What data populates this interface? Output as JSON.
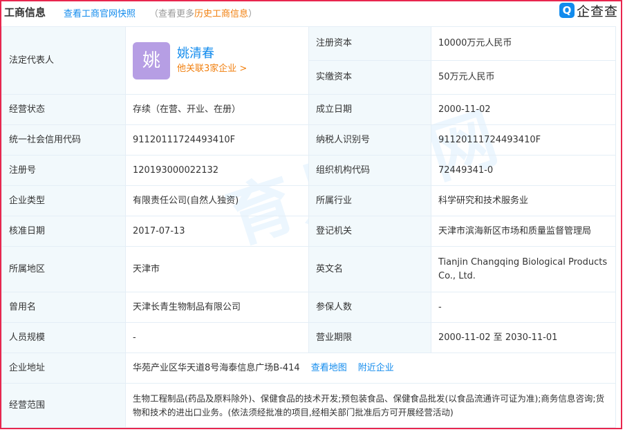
{
  "header": {
    "title": "工商信息",
    "snapshot_link": "查看工商官网快照",
    "more_prefix": "（查看更多",
    "history_link": "历史工商信息",
    "more_suffix": "）",
    "brand_logo": "Q",
    "brand_name": "企查查"
  },
  "legal_rep": {
    "label": "法定代表人",
    "avatar_char": "姚",
    "name": "姚清春",
    "related": "他关联3家企业 >"
  },
  "rows": {
    "reg_capital": {
      "label": "注册资本",
      "value": "10000万元人民币"
    },
    "paid_capital": {
      "label": "实缴资本",
      "value": "50万元人民币"
    },
    "status": {
      "label": "经营状态",
      "value": "存续（在营、开业、在册）"
    },
    "found_date": {
      "label": "成立日期",
      "value": "2000-11-02"
    },
    "credit_code": {
      "label": "统一社会信用代码",
      "value": "91120111724493410F"
    },
    "taxpayer_id": {
      "label": "纳税人识别号",
      "value": "91120111724493410F"
    },
    "reg_no": {
      "label": "注册号",
      "value": "120193000022132"
    },
    "org_code": {
      "label": "组织机构代码",
      "value": "72449341-0"
    },
    "company_type": {
      "label": "企业类型",
      "value": "有限责任公司(自然人独资)"
    },
    "industry": {
      "label": "所属行业",
      "value": "科学研究和技术服务业"
    },
    "approval_date": {
      "label": "核准日期",
      "value": "2017-07-13"
    },
    "authority": {
      "label": "登记机关",
      "value": "天津市滨海新区市场和质量监督管理局"
    },
    "region": {
      "label": "所属地区",
      "value": "天津市"
    },
    "english_name": {
      "label": "英文名",
      "value": "Tianjin Changqing Biological Products Co., Ltd."
    },
    "former_name": {
      "label": "曾用名",
      "value": "天津长青生物制品有限公司"
    },
    "insured": {
      "label": "参保人数",
      "value": "-"
    },
    "staff_size": {
      "label": "人员规模",
      "value": "-"
    },
    "term": {
      "label": "营业期限",
      "value": "2000-11-02 至 2030-11-01"
    },
    "address": {
      "label": "企业地址",
      "value": "华苑产业区华天道8号海泰信息广场B-414",
      "map_link": "查看地图",
      "nearby_link": "附近企业"
    },
    "scope": {
      "label": "经营范围",
      "value": "生物工程制品(药品及原料除外)、保健食品的技术开发;预包装食品、保健食品批发(以食品流通许可证为准);商务信息咨询;货物和技术的进出口业务。(依法须经批准的项目,经相关部门批准后方可开展经营活动)"
    }
  },
  "watermark": "育儿窝网",
  "colors": {
    "accent": "#128bed",
    "orange": "#f17f0e",
    "label_bg": "#f2f9fc",
    "border": "#e8264e"
  }
}
